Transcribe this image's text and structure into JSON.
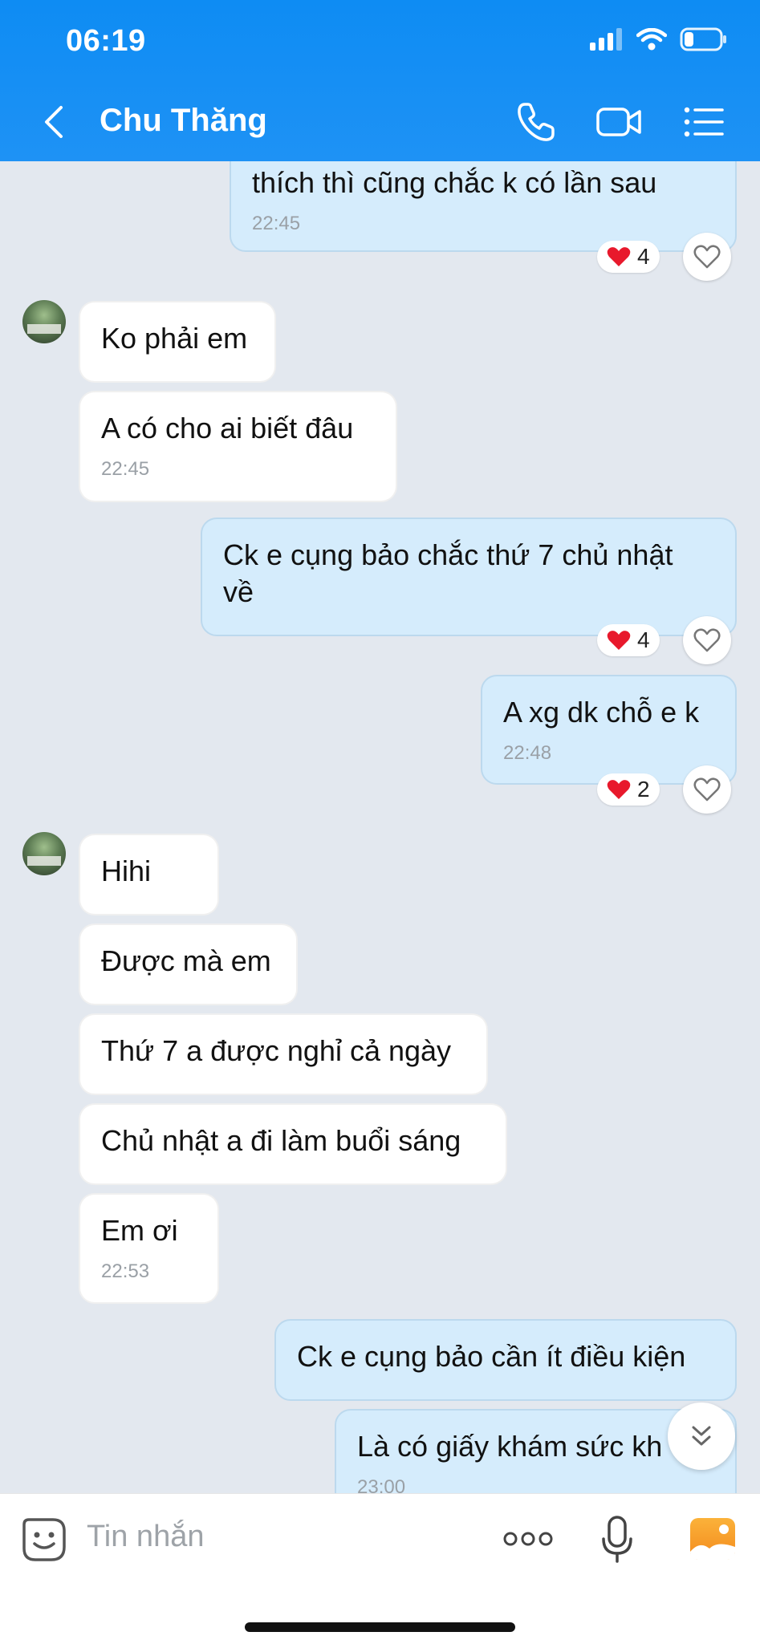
{
  "status": {
    "time": "06:19"
  },
  "header": {
    "title": "Chu Thăng"
  },
  "messages": [
    {
      "dir": "out",
      "text": "thích thì cũng chắc k có lần sau",
      "time": "22:45",
      "reaction": {
        "count": "4"
      }
    },
    {
      "dir": "in",
      "text": "Ko phải em"
    },
    {
      "dir": "in",
      "text": "A có cho ai biết đâu",
      "time": "22:45"
    },
    {
      "dir": "out",
      "text": "Ck e cụng bảo chắc thứ 7 chủ nhật về",
      "reaction": {
        "count": "4"
      }
    },
    {
      "dir": "out",
      "text": "A xg dk chỗ e k",
      "time": "22:48",
      "reaction": {
        "count": "2"
      }
    },
    {
      "dir": "in",
      "text": "Hihi"
    },
    {
      "dir": "in",
      "text": "Được mà em"
    },
    {
      "dir": "in",
      "text": "Thứ 7 a được nghỉ cả ngày"
    },
    {
      "dir": "in",
      "text": "Chủ nhật a đi làm buổi sáng"
    },
    {
      "dir": "in",
      "text": "Em ơi",
      "time": "22:53"
    },
    {
      "dir": "out",
      "text": "Ck e cụng bảo cần ít điều kiện"
    },
    {
      "dir": "out",
      "text": "Là có giấy khám sức kh",
      "time": "23:00"
    }
  ],
  "input": {
    "placeholder": "Tin nhắn"
  },
  "colors": {
    "header": "#0e8cf3",
    "outgoing_bubble": "#d5ecfc",
    "incoming_bubble": "#ffffff",
    "background": "#e3e8ef",
    "heart": "#e8192c"
  }
}
